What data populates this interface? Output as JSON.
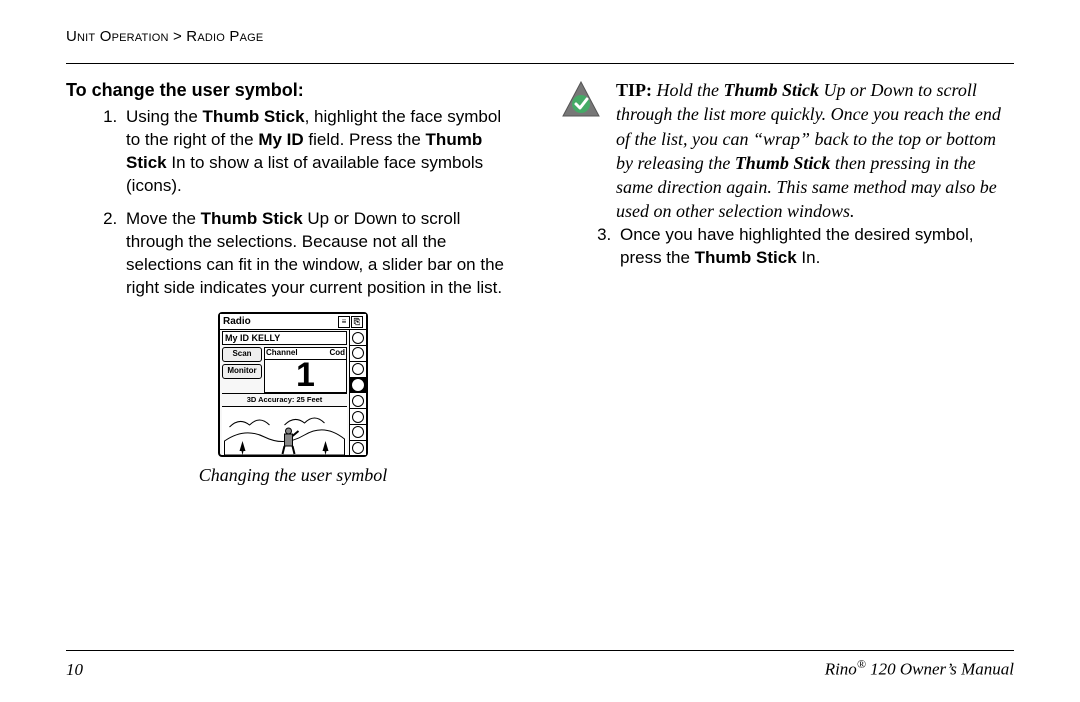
{
  "breadcrumb": "Unit Operation > Radio Page",
  "section_title": "To change the user symbol:",
  "steps": {
    "s1": {
      "pre": "Using the ",
      "b1": "Thumb Stick",
      "mid1": ", highlight the face symbol to the right of the ",
      "b2": "My ID",
      "mid2": " field. Press the ",
      "b3": "Thumb Stick",
      "post": " In to show a list of available face symbols (icons)."
    },
    "s2": {
      "pre": "Move the ",
      "b1": "Thumb Stick",
      "post": " Up or Down to scroll through the selections. Because not all the selections can fit in the window, a slider bar on the right side indicates your current position in the list."
    },
    "s3": {
      "pre": "Once you have highlighted the desired symbol, press the ",
      "b1": "Thumb Stick",
      "post": " In."
    }
  },
  "figure": {
    "caption": "Changing the user symbol",
    "title": "Radio",
    "myid_label": "My ID",
    "myid_value": "KELLY",
    "btn_scan": "Scan",
    "btn_monitor": "Monitor",
    "channel_label": "Channel",
    "code_label": "Cod",
    "channel_value": "1",
    "accuracy": "3D Accuracy: 25 Feet"
  },
  "tip": {
    "label": "TIP:",
    "t1": " Hold the ",
    "b1": "Thumb Stick",
    "t2": " Up or Down to scroll through the list more quickly. Once you reach the end of the list, you can “wrap” back to the top or bottom by releasing the ",
    "b2": "Thumb Stick",
    "t3": " then pressing in the same direction again. This same method may also be used on other selection windows."
  },
  "footer": {
    "page": "10",
    "product_pre": "Rino",
    "product_reg": "®",
    "product_post": " 120 Owner’s Manual"
  }
}
